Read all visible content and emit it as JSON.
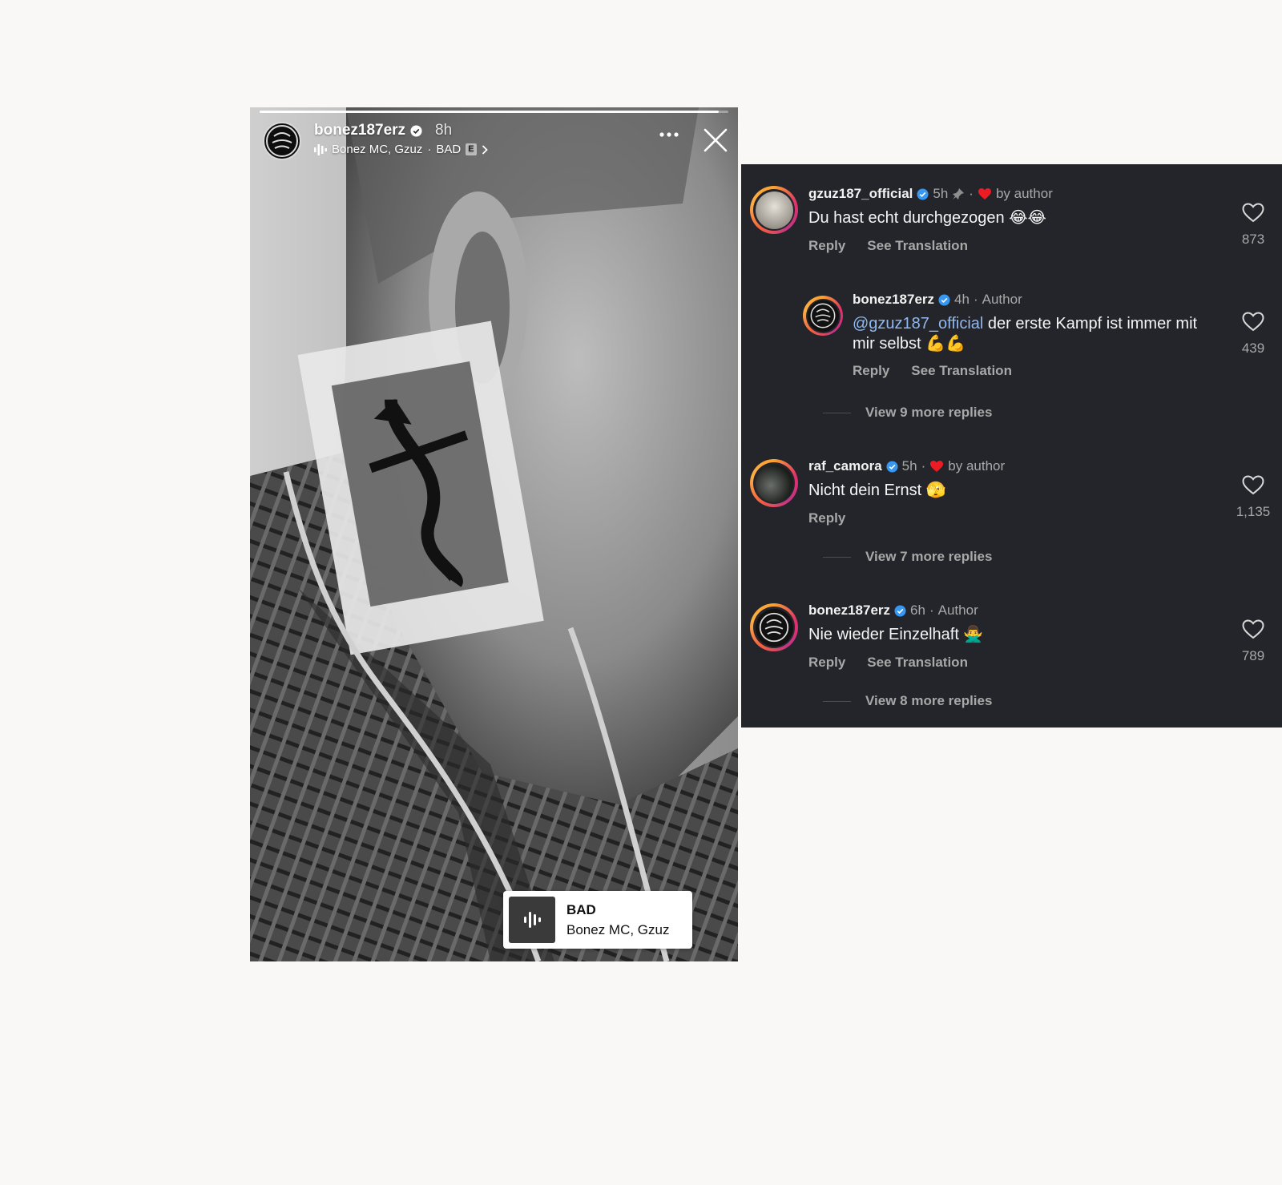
{
  "story": {
    "username": "bonez187erz",
    "time": "8h",
    "music_artists": "Bonez MC, Gzuz",
    "music_sep": "·",
    "music_track": "BAD",
    "explicit_badge": "E",
    "progress": 0.98,
    "sticker": {
      "title": "BAD",
      "artist": "Bonez MC, Gzuz"
    },
    "icons": [
      "verified-badge-icon",
      "audio-bars-icon",
      "chevron-right-icon",
      "more-options-icon",
      "close-icon"
    ]
  },
  "comments": {
    "items": [
      {
        "username": "gzuz187_official",
        "time": "5h",
        "pinned": true,
        "liked_by_author_label": "by author",
        "text": "Du hast echt durchgezogen 😂😂",
        "reply_label": "Reply",
        "translate_label": "See Translation",
        "likes": "873"
      },
      {
        "username": "bonez187erz",
        "time": "4h",
        "author_label": "Author",
        "mention": "@gzuz187_official",
        "text": " der erste Kampf ist immer mit mir selbst 💪💪",
        "reply_label": "Reply",
        "translate_label": "See Translation",
        "likes": "439"
      },
      {
        "username": "raf_camora",
        "time": "5h",
        "liked_by_author_label": "by author",
        "text": "Nicht dein Ernst 🫣",
        "reply_label": "Reply",
        "likes": "1,135"
      },
      {
        "username": "bonez187erz",
        "time": "6h",
        "author_label": "Author",
        "text": "Nie wieder Einzelhaft 🙅‍♂️",
        "reply_label": "Reply",
        "translate_label": "See Translation",
        "likes": "789"
      }
    ],
    "view_more": [
      "View 9 more replies",
      "View 7 more replies",
      "View 8 more replies"
    ],
    "colors": {
      "background": "#23252a",
      "verified": "#3897f0",
      "heart": "#ed1c24",
      "mention": "#8fb9f0"
    }
  }
}
